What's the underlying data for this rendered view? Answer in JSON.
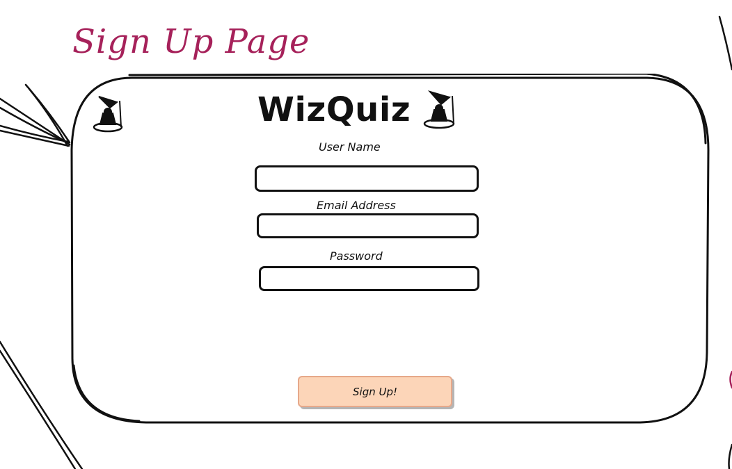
{
  "page": {
    "title": "Sign Up Page"
  },
  "brand": {
    "name": "WizQuiz",
    "icon": "wizard-icon"
  },
  "form": {
    "username_label": "User Name",
    "username_value": "",
    "email_label": "Email Address",
    "email_value": "",
    "password_label": "Password",
    "password_value": "",
    "submit_label": "Sign Up!"
  },
  "colors": {
    "title": "#a6215a",
    "button_fill": "#fcd5b8",
    "ink": "#111111"
  }
}
